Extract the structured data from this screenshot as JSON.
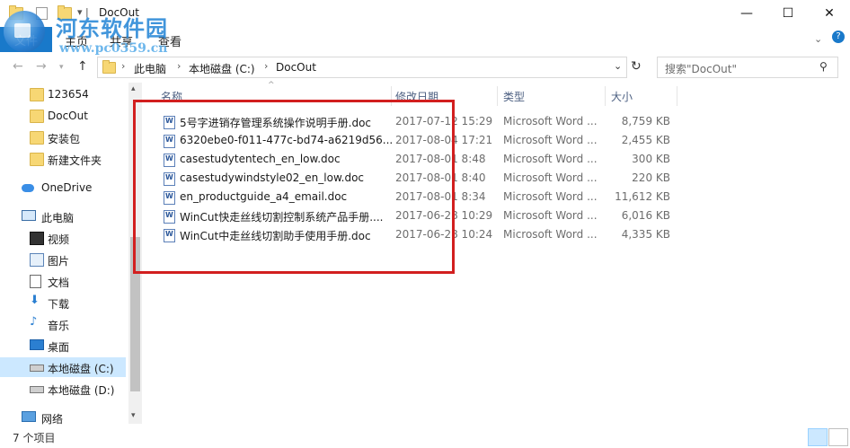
{
  "window": {
    "title": "DocOut",
    "controls": {
      "minimize": "—",
      "maximize": "☐",
      "close": "✕"
    }
  },
  "watermark": {
    "brand": "河东软件园",
    "site": "www.pc0359.cn"
  },
  "ribbon": {
    "file": "文件",
    "tabs": [
      "主页",
      "共享",
      "查看"
    ]
  },
  "address": {
    "crumbs": [
      "此电脑",
      "本地磁盘 (C:)",
      "DocOut"
    ],
    "search_placeholder": "搜索\"DocOut\""
  },
  "nav_pane": {
    "items": [
      {
        "label": "123654",
        "icon": "folder-icon",
        "selected": false,
        "group": false
      },
      {
        "label": "DocOut",
        "icon": "folder-icon",
        "selected": false,
        "group": false
      },
      {
        "label": "安装包",
        "icon": "folder-icon",
        "selected": false,
        "group": false
      },
      {
        "label": "新建文件夹",
        "icon": "folder-icon",
        "selected": false,
        "group": false
      },
      {
        "label": "OneDrive",
        "icon": "cloud-icon",
        "selected": false,
        "group": true
      },
      {
        "label": "此电脑",
        "icon": "computer-icon",
        "selected": false,
        "group": true
      },
      {
        "label": "视频",
        "icon": "video-icon",
        "selected": false,
        "group": false
      },
      {
        "label": "图片",
        "icon": "picture-icon",
        "selected": false,
        "group": false
      },
      {
        "label": "文档",
        "icon": "document-icon",
        "selected": false,
        "group": false
      },
      {
        "label": "下载",
        "icon": "download-icon",
        "selected": false,
        "group": false
      },
      {
        "label": "音乐",
        "icon": "music-icon",
        "selected": false,
        "group": false
      },
      {
        "label": "桌面",
        "icon": "desktop-icon",
        "selected": false,
        "group": false
      },
      {
        "label": "本地磁盘 (C:)",
        "icon": "drive-icon",
        "selected": true,
        "group": false
      },
      {
        "label": "本地磁盘 (D:)",
        "icon": "drive-icon",
        "selected": false,
        "group": false
      },
      {
        "label": "网络",
        "icon": "network-icon",
        "selected": false,
        "group": true
      }
    ]
  },
  "file_list": {
    "columns": [
      "名称",
      "修改日期",
      "类型",
      "大小"
    ],
    "rows": [
      {
        "name": "5号字进销存管理系统操作说明手册.doc",
        "date": "2017-07-12 15:29",
        "type": "Microsoft Word ...",
        "size": "8,759 KB"
      },
      {
        "name": "6320ebe0-f011-477c-bd74-a6219d56...",
        "date": "2017-08-04 17:21",
        "type": "Microsoft Word ...",
        "size": "2,455 KB"
      },
      {
        "name": "casestudytentech_en_low.doc",
        "date": "2017-08-01 8:48",
        "type": "Microsoft Word ...",
        "size": "300 KB"
      },
      {
        "name": "casestudywindstyle02_en_low.doc",
        "date": "2017-08-01 8:40",
        "type": "Microsoft Word ...",
        "size": "220 KB"
      },
      {
        "name": "en_productguide_a4_email.doc",
        "date": "2017-08-01 8:34",
        "type": "Microsoft Word ...",
        "size": "11,612 KB"
      },
      {
        "name": "WinCut快走丝线切割控制系统产品手册....",
        "date": "2017-06-28 10:29",
        "type": "Microsoft Word ...",
        "size": "6,016 KB"
      },
      {
        "name": "WinCut中走丝线切割助手使用手册.doc",
        "date": "2017-06-28 10:24",
        "type": "Microsoft Word ...",
        "size": "4,335 KB"
      }
    ]
  },
  "status": {
    "count": "7 个项目"
  },
  "colors": {
    "accent": "#1979ca",
    "selection": "#cce8ff",
    "highlight_box": "#d21f1f"
  }
}
